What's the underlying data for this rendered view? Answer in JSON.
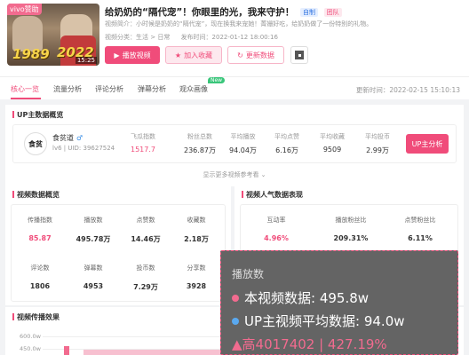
{
  "video": {
    "title": "给奶奶的“隔代宠”！你眼里的光，我来守护！",
    "tags": [
      "自制",
      "团队"
    ],
    "desc": "视频简介：小时候是奶奶的“隔代宠”，现在换我来宠她！菁姗好吃，给奶奶做了一份特别的礼物。",
    "category_label": "视频分类：生活 > 日常",
    "publish_time": "发布时间：2022-01-12 18:00:16",
    "thumb": {
      "logo": "vivo赞助",
      "year_left": "1989",
      "year_right": "2022",
      "duration": "15:25"
    }
  },
  "actions": {
    "play": "播放视频",
    "favorite": "加入收藏",
    "update": "更新数据"
  },
  "tabs": [
    "核心一览",
    "流量分析",
    "评论分析",
    "弹幕分析",
    "观众画像"
  ],
  "new_badge": "New",
  "update_time": "更新时间：2022-02-15 15:10:13",
  "up": {
    "section": "UP主数据概览",
    "avatar_text": "食贫",
    "name": "食贫道",
    "level_uid": "lv6 | UID: 39627524",
    "stats": [
      {
        "label": "飞瓜指数",
        "value": "1517.7"
      },
      {
        "label": "粉丝总数",
        "value": "236.87万"
      },
      {
        "label": "平均播放",
        "value": "94.04万"
      },
      {
        "label": "平均点赞",
        "value": "6.16万"
      },
      {
        "label": "平均收藏",
        "value": "9509"
      },
      {
        "label": "平均投币",
        "value": "2.99万"
      }
    ],
    "analyze_button": "UP主分析",
    "more": "显示更多视频参考看 ⌄"
  },
  "overview": {
    "section": "视频数据概览",
    "row1": [
      {
        "label": "传播指数",
        "value": "85.87"
      },
      {
        "label": "播放数",
        "value": "495.78万"
      },
      {
        "label": "点赞数",
        "value": "14.46万"
      },
      {
        "label": "收藏数",
        "value": "2.18万"
      }
    ],
    "row2": [
      {
        "label": "评论数",
        "value": "1806"
      },
      {
        "label": "弹幕数",
        "value": "4953"
      },
      {
        "label": "投币数",
        "value": "7.29万"
      },
      {
        "label": "分享数",
        "value": "3928"
      }
    ]
  },
  "popularity": {
    "section": "视频人气数据表现",
    "items": [
      {
        "label": "互动率",
        "value": "4.96%"
      },
      {
        "label": "播放粉丝比",
        "value": "209.31%"
      },
      {
        "label": "点赞粉丝比",
        "value": "6.11%"
      }
    ]
  },
  "spread": {
    "section": "视频传播效果",
    "y_ticks": [
      "600.0w",
      "450.0w"
    ]
  },
  "tooltip": {
    "title": "播放数",
    "row1": "本视频数据:  495.8w",
    "row2": "UP主视频平均数据:  94.0w",
    "row3": "▲高4017402 | 427.19%",
    "colors": {
      "current": "#f26b8f",
      "average": "#5aa9f0"
    }
  }
}
